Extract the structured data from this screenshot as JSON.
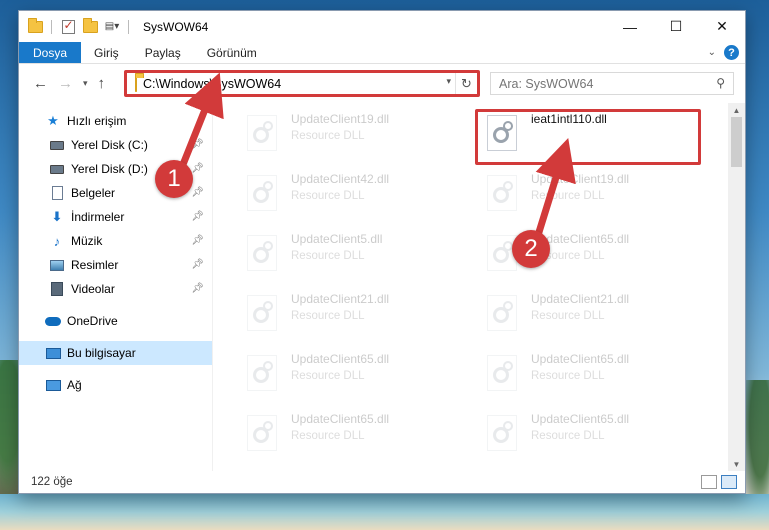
{
  "window": {
    "title": "SysWOW64",
    "controls": {
      "minimize": "—",
      "maximize": "☐",
      "close": "✕"
    }
  },
  "ribbon": {
    "tabs": [
      "Dosya",
      "Giriş",
      "Paylaş",
      "Görünüm"
    ],
    "help": "?"
  },
  "navigation": {
    "address": "C:\\Windows\\SysWOW64",
    "search_placeholder": "Ara: SysWOW64"
  },
  "sidebar": {
    "items": [
      {
        "label": "Hızlı erişim",
        "icon": "star-icon"
      },
      {
        "label": "Yerel Disk (C:)",
        "icon": "drive-icon",
        "pinned": true
      },
      {
        "label": "Yerel Disk (D:)",
        "icon": "drive-icon",
        "pinned": true
      },
      {
        "label": "Belgeler",
        "icon": "document-icon",
        "pinned": true
      },
      {
        "label": "İndirmeler",
        "icon": "download-icon",
        "pinned": true
      },
      {
        "label": "Müzik",
        "icon": "music-icon",
        "pinned": true
      },
      {
        "label": "Resimler",
        "icon": "pictures-icon",
        "pinned": true
      },
      {
        "label": "Videolar",
        "icon": "videos-icon",
        "pinned": true
      },
      {
        "label": "OneDrive",
        "icon": "cloud-icon"
      },
      {
        "label": "Bu bilgisayar",
        "icon": "computer-icon",
        "selected": true
      },
      {
        "label": "Ağ",
        "icon": "network-icon"
      }
    ]
  },
  "files": {
    "left": [
      {
        "name": "UpdateClient19.dll",
        "type": "Resource DLL"
      },
      {
        "name": "UpdateClient42.dll",
        "type": "Resource DLL"
      },
      {
        "name": "UpdateClient5.dll",
        "type": "Resource DLL"
      },
      {
        "name": "UpdateClient21.dll",
        "type": "Resource DLL"
      },
      {
        "name": "UpdateClient65.dll",
        "type": "Resource DLL"
      },
      {
        "name": "UpdateClient65.dll",
        "type": "Resource DLL"
      }
    ],
    "right": [
      {
        "name": "ieat1intl110.dll",
        "type": ""
      },
      {
        "name": "UpdateClient19.dll",
        "type": "Resource DLL"
      },
      {
        "name": "UpdateClient65.dll",
        "type": "Resource DLL"
      },
      {
        "name": "UpdateClient21.dll",
        "type": "Resource DLL"
      },
      {
        "name": "UpdateClient65.dll",
        "type": "Resource DLL"
      },
      {
        "name": "UpdateClient65.dll",
        "type": "Resource DLL"
      }
    ]
  },
  "status": {
    "item_count": "122 öğe"
  },
  "annotations": {
    "step1": "1",
    "step2": "2",
    "color": "#d23a3a"
  }
}
